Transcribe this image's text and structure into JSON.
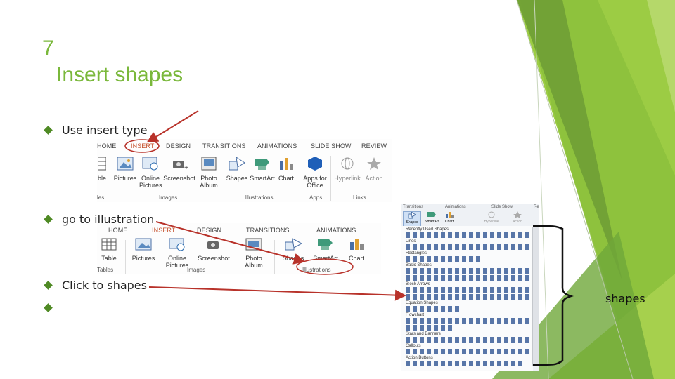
{
  "slide": {
    "number": "7",
    "title": "Insert shapes"
  },
  "bullets": [
    {
      "text": "Use insert type"
    },
    {
      "text": "go to illustration"
    },
    {
      "text": "Click to shapes"
    },
    {
      "text": ""
    }
  ],
  "ribbon1": {
    "tabs": [
      "HOME",
      "INSERT",
      "DESIGN",
      "TRANSITIONS",
      "ANIMATIONS",
      "SLIDE SHOW",
      "REVIEW"
    ],
    "active_tab": "INSERT",
    "buttons": [
      {
        "label": "ble",
        "icon": "table-icon"
      },
      {
        "label": "Pictures",
        "icon": "pictures-icon"
      },
      {
        "label": "Online Pictures",
        "icon": "online-pictures-icon"
      },
      {
        "label": "Screenshot",
        "icon": "screenshot-icon"
      },
      {
        "label": "Photo Album",
        "icon": "photo-album-icon"
      },
      {
        "label": "Shapes",
        "icon": "shapes-icon"
      },
      {
        "label": "SmartArt",
        "icon": "smartart-icon"
      },
      {
        "label": "Chart",
        "icon": "chart-icon"
      },
      {
        "label": "Apps for Office",
        "icon": "apps-icon"
      },
      {
        "label": "Hyperlink",
        "icon": "hyperlink-icon"
      },
      {
        "label": "Action",
        "icon": "action-icon"
      }
    ],
    "groups": [
      "les",
      "Images",
      "Illustrations",
      "Apps",
      "Links"
    ]
  },
  "ribbon2": {
    "tabs": [
      "HOME",
      "INSERT",
      "DESIGN",
      "TRANSITIONS",
      "ANIMATIONS"
    ],
    "active_tab": "INSERT",
    "buttons": [
      {
        "label": "Table",
        "icon": "table-icon"
      },
      {
        "label": "Pictures",
        "icon": "pictures-icon"
      },
      {
        "label": "Online Pictures",
        "icon": "online-pictures-icon"
      },
      {
        "label": "Screenshot",
        "icon": "screenshot-icon"
      },
      {
        "label": "Photo Album",
        "icon": "photo-album-icon"
      },
      {
        "label": "Shapes",
        "icon": "shapes-icon"
      },
      {
        "label": "SmartArt",
        "icon": "smartart-icon"
      },
      {
        "label": "Chart",
        "icon": "chart-icon"
      }
    ],
    "groups": [
      "Tables",
      "Images",
      "Illustrations"
    ]
  },
  "gallery": {
    "tabs": [
      "Transitions",
      "Animations",
      "Slide Show",
      "Re"
    ],
    "buttons": [
      "Shapes",
      "SmartArt",
      "Chart",
      "Hyperlink",
      "Action"
    ],
    "categories": [
      "Recently Used Shapes",
      "Lines",
      "Rectangles",
      "Basic Shapes",
      "Block Arrows",
      "Equation Shapes",
      "Flowchart",
      "Stars and Banners",
      "Callouts",
      "Action Buttons"
    ]
  },
  "annotation": {
    "label": "shapes"
  },
  "colors": {
    "title_green": "#7ab83b",
    "bullet_green": "#4f8a24",
    "arrow_red": "#b8322a",
    "active_tab": "#c5502c",
    "deco_light": "#a6d04d",
    "deco_mid": "#8cc03c",
    "deco_dark": "#6f9e35"
  }
}
